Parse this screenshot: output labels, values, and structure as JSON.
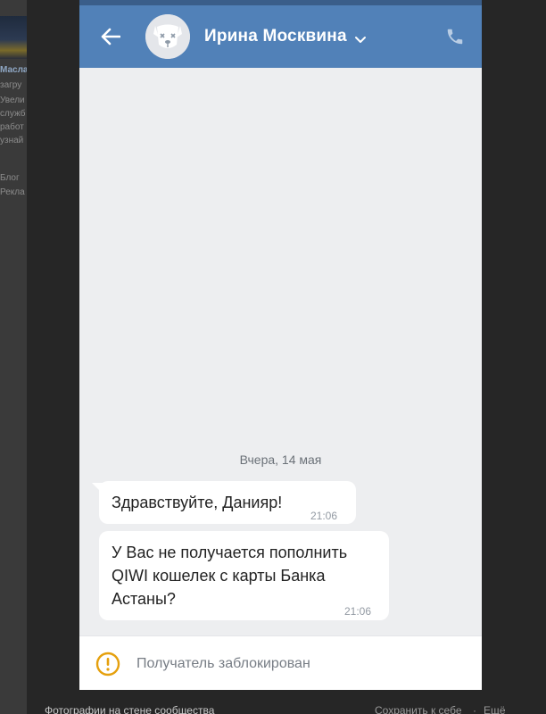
{
  "background_page": {
    "lines": [
      "Масла",
      "загру",
      "Увели",
      "служб",
      "работ",
      "узнай",
      "Блог",
      "Рекла"
    ]
  },
  "chat": {
    "contact_name": "Ирина Москвина",
    "date_separator": "Вчера, 14 мая",
    "messages": [
      {
        "text": "Здравствуйте, Данияр!",
        "time": "21:06"
      },
      {
        "text": "У Вас не получается пополнить QIWI кошелек с карты Банка Астаны?",
        "time": "21:06"
      }
    ],
    "blocked_notice": "Получатель заблокирован"
  },
  "page_footer": {
    "left_text": "Фотографии на стене сообщества",
    "save_link": "Сохранить к себе",
    "dot": "·",
    "more_link": "Ещё"
  },
  "icons": {
    "back": "arrow-left-icon",
    "avatar": "deactivated-dog-avatar",
    "chevron": "chevron-down-icon",
    "call": "phone-icon",
    "warning": "warning-circle-icon"
  },
  "colors": {
    "header": "#5181b8",
    "chat_bg": "#edeef0",
    "bubble": "#ffffff",
    "warning": "#e5a00d",
    "overlay": "#262626"
  }
}
